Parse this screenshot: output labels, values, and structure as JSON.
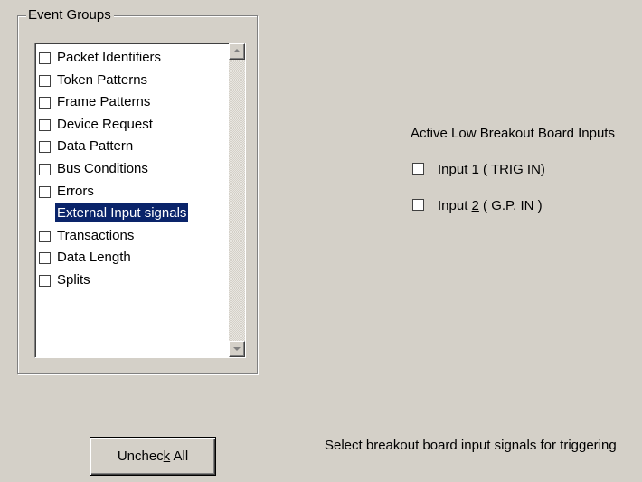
{
  "event_groups": {
    "label": "Event Groups",
    "items": [
      {
        "label": "Packet Identifiers",
        "checked": false,
        "selected": false
      },
      {
        "label": "Token Patterns",
        "checked": false,
        "selected": false
      },
      {
        "label": "Frame Patterns",
        "checked": false,
        "selected": false
      },
      {
        "label": "Device Request",
        "checked": false,
        "selected": false
      },
      {
        "label": "Data Pattern",
        "checked": false,
        "selected": false
      },
      {
        "label": "Bus Conditions",
        "checked": false,
        "selected": false
      },
      {
        "label": "Errors",
        "checked": false,
        "selected": false
      },
      {
        "label": "External Input signals",
        "checked": false,
        "selected": true
      },
      {
        "label": "Transactions",
        "checked": false,
        "selected": false
      },
      {
        "label": "Data Length",
        "checked": false,
        "selected": false
      },
      {
        "label": "Splits",
        "checked": false,
        "selected": false
      }
    ]
  },
  "breakout": {
    "title": "Active Low Breakout Board Inputs",
    "input1": {
      "prefix": "Input ",
      "hotkey": "1",
      "suffix": " ( TRIG IN)",
      "checked": false
    },
    "input2": {
      "prefix": "Input ",
      "hotkey": "2",
      "suffix": " ( G.P. IN )",
      "checked": false
    }
  },
  "uncheck_button": {
    "prefix": "Unchec",
    "hotkey": "k",
    "suffix": " All"
  },
  "status_text": "Select breakout board input signals for triggering",
  "colors": {
    "background": "#d4d0c8",
    "selection": "#0a246a",
    "selection_text": "#ffffff"
  },
  "icons": {
    "scroll_up": "scroll-up-arrow-icon",
    "scroll_down": "scroll-down-arrow-icon"
  }
}
